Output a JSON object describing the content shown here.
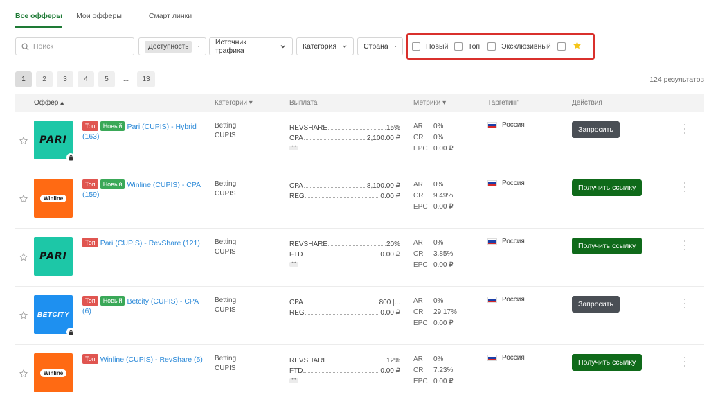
{
  "tabs": [
    {
      "label": "Все офферы",
      "active": true
    },
    {
      "label": "Мои офферы",
      "active": false
    },
    {
      "label": "Смарт линки",
      "active": false
    }
  ],
  "filters": {
    "search_placeholder": "Поиск",
    "availability_chip": "Доступность",
    "traffic_source": "Источник трафика",
    "category": "Категория",
    "country": "Страна",
    "cb_new": "Новый",
    "cb_top": "Топ",
    "cb_exclusive": "Эксклюзивный",
    "highlight_color": "#d9302c"
  },
  "pagination": {
    "pages": [
      "1",
      "2",
      "3",
      "4",
      "5",
      "...",
      "13"
    ],
    "results": "124 результатов"
  },
  "table": {
    "headers": {
      "offer": "Оффер ▴",
      "categories": "Категории ▾",
      "payout": "Выплата",
      "metrics": "Метрики ▾",
      "targeting": "Таргетинг",
      "actions": "Действия"
    },
    "rows": [
      {
        "logo": "PARI",
        "logo_bg": "#1dc7a7",
        "locked": true,
        "badge_top": "Топ",
        "badge_new": "Новый",
        "name": "Pari (CUPIS) - Hybrid (163)",
        "cat1": "Betting",
        "cat2": "CUPIS",
        "pay": [
          {
            "label": "REVSHARE",
            "value": "15%"
          },
          {
            "label": "CPA",
            "value": "2,100.00 ₽"
          }
        ],
        "more": true,
        "ar_k": "AR",
        "ar": "0%",
        "cr_k": "CR",
        "cr": "0%",
        "epc_k": "EPC",
        "epc": "0.00 ₽",
        "geo": "Россия",
        "action": "Запросить",
        "action_type": "req"
      },
      {
        "logo": "Winline",
        "logo_bg": "#ff6a13",
        "locked": false,
        "badge_top": "Топ",
        "badge_new": "Новый",
        "name": "Winline (CUPIS) - CPA (159)",
        "cat1": "Betting",
        "cat2": "CUPIS",
        "pay": [
          {
            "label": "CPA",
            "value": "8,100.00 ₽"
          },
          {
            "label": "REG",
            "value": "0.00 ₽"
          }
        ],
        "more": false,
        "ar_k": "AR",
        "ar": "0%",
        "cr_k": "CR",
        "cr": "9.49%",
        "epc_k": "EPC",
        "epc": "0.00 ₽",
        "geo": "Россия",
        "action": "Получить ссылку",
        "action_type": "get"
      },
      {
        "logo": "PARI",
        "logo_bg": "#1dc7a7",
        "locked": false,
        "badge_top": "Топ",
        "badge_new": "",
        "name": "Pari (CUPIS) - RevShare (121)",
        "cat1": "Betting",
        "cat2": "CUPIS",
        "pay": [
          {
            "label": "REVSHARE",
            "value": "20%"
          },
          {
            "label": "FTD",
            "value": "0.00 ₽"
          }
        ],
        "more": true,
        "ar_k": "AR",
        "ar": "0%",
        "cr_k": "CR",
        "cr": "3.85%",
        "epc_k": "EPC",
        "epc": "0.00 ₽",
        "geo": "Россия",
        "action": "Получить ссылку",
        "action_type": "get"
      },
      {
        "logo": "BETCITY",
        "logo_bg": "#1e90f0",
        "locked": true,
        "badge_top": "Топ",
        "badge_new": "Новый",
        "name": "Betcity (CUPIS) - CPA (6)",
        "cat1": "Betting",
        "cat2": "CUPIS",
        "pay": [
          {
            "label": "CPA",
            "value": "800 |..."
          },
          {
            "label": "REG",
            "value": "0.00 ₽"
          }
        ],
        "more": false,
        "ar_k": "AR",
        "ar": "0%",
        "cr_k": "CR",
        "cr": "29.17%",
        "epc_k": "EPC",
        "epc": "0.00 ₽",
        "geo": "Россия",
        "action": "Запросить",
        "action_type": "req"
      },
      {
        "logo": "Winline",
        "logo_bg": "#ff6a13",
        "locked": false,
        "badge_top": "Топ",
        "badge_new": "",
        "name": "Winline (CUPIS) - RevShare (5)",
        "cat1": "Betting",
        "cat2": "CUPIS",
        "pay": [
          {
            "label": "REVSHARE",
            "value": "12%"
          },
          {
            "label": "FTD",
            "value": "0.00 ₽"
          }
        ],
        "more": true,
        "ar_k": "AR",
        "ar": "0%",
        "cr_k": "CR",
        "cr": "7.23%",
        "epc_k": "EPC",
        "epc": "0.00 ₽",
        "geo": "Россия",
        "action": "Получить ссылку",
        "action_type": "get"
      }
    ]
  }
}
